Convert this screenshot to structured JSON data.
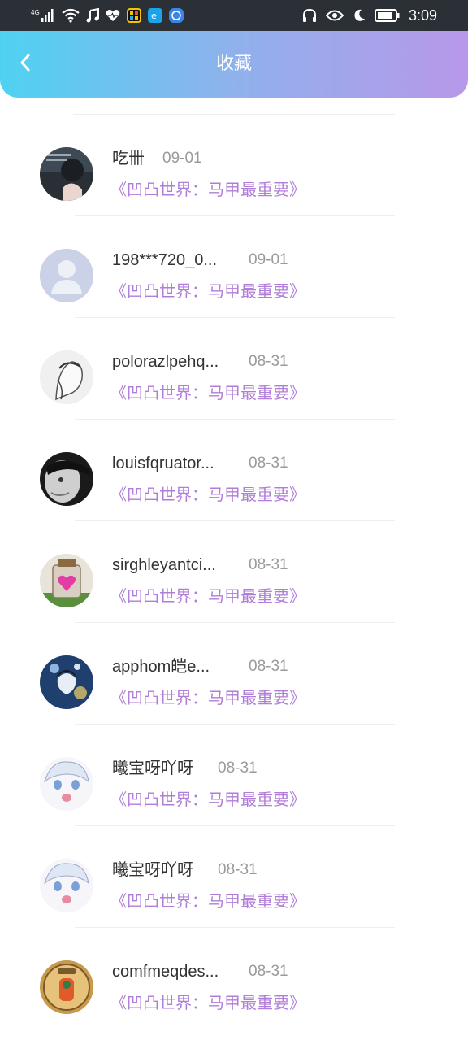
{
  "status_bar": {
    "network": "4G",
    "time": "3:09"
  },
  "header": {
    "title": "收藏"
  },
  "items": [
    {
      "name": "吃卌",
      "date": "09-01",
      "book": "《凹凸世界：马甲最重要》",
      "avatar": "avatar-1"
    },
    {
      "name": "198***720_0...",
      "date": "09-01",
      "book": "《凹凸世界：马甲最重要》",
      "avatar": "default-avatar"
    },
    {
      "name": "polorazlpehq...",
      "date": "08-31",
      "book": "《凹凸世界：马甲最重要》",
      "avatar": "avatar-3"
    },
    {
      "name": "louisfqruator...",
      "date": "08-31",
      "book": "《凹凸世界：马甲最重要》",
      "avatar": "avatar-4"
    },
    {
      "name": "sirghleyantci...",
      "date": "08-31",
      "book": "《凹凸世界：马甲最重要》",
      "avatar": "avatar-5"
    },
    {
      "name": "apphom皑e...",
      "date": "08-31",
      "book": "《凹凸世界：马甲最重要》",
      "avatar": "avatar-6"
    },
    {
      "name": "曦宝呀吖呀",
      "date": "08-31",
      "book": "《凹凸世界：马甲最重要》",
      "avatar": "avatar-7"
    },
    {
      "name": "曦宝呀吖呀",
      "date": "08-31",
      "book": "《凹凸世界：马甲最重要》",
      "avatar": "avatar-8"
    },
    {
      "name": "comfmeqdes...",
      "date": "08-31",
      "book": "《凹凸世界：马甲最重要》",
      "avatar": "avatar-9"
    }
  ],
  "colors": {
    "header_gradient_start": "#4fd2f2",
    "header_gradient_end": "#b898ea",
    "book_title": "#b07ed8"
  }
}
